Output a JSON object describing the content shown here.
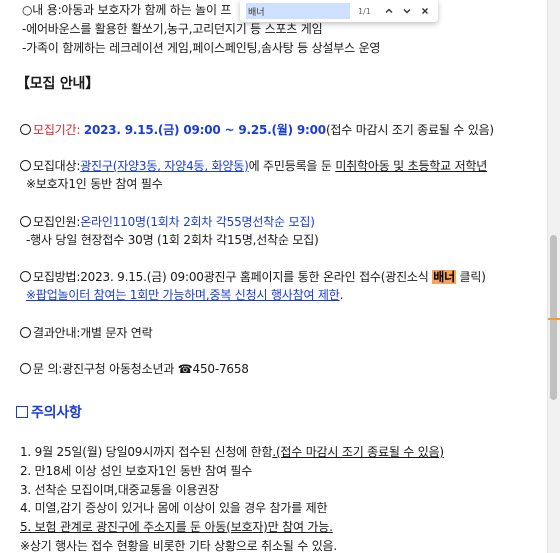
{
  "find_bar": {
    "query": "배너",
    "count": "1/1",
    "prev_icon": "chevron-up-icon",
    "next_icon": "chevron-down-icon",
    "close_icon": "close-icon"
  },
  "intro": {
    "content_label": "○내 용:아동과 보호자가 함께 하는 놀이 프",
    "content_line2": "-에어바운스를 활용한 활쏘기,농구,고리던지기 등 스포츠 게임",
    "content_line3": "-가족이 함께하는 레크레이션 게임,페이스페인팅,솜사탕 등 상설부스 운영"
  },
  "recruit": {
    "heading": "【모집 안내】",
    "period_label": "모집기간: ",
    "period_value": "2023. 9.15.(금) 09:00 ~ 9.25.(월) 9:00",
    "period_note": "(접수 마감시 조기 종료될 수 있음)",
    "target_label": "모집대상:",
    "target_value": "광진구(자양3동, 자양4동, 화양동)",
    "target_rest": "에 주민등록을 둔 ",
    "target_underline": "미취학아동 및 초등학교 저학년",
    "target_note": "※보호자1인 동반 참여 필수",
    "people_label": "모집인원:",
    "people_value": "온라인110명(1회차 2회차 각55명선착순 모집)",
    "people_note": "-행사 당일 현장접수 30명 (1회 2회차 각15명,선착순 모집)",
    "method_prefix": "모집방법:2023. 9.15.(금) 09:00광진구 홈페이지를 통한 온라인 접수(광진소식 ",
    "method_highlight": "배너",
    "method_suffix": " 클릭)",
    "method_note": "※팝업놀이터 참여는 1회만 가능하며,중복 신청시 행사참여 제한",
    "method_note_end": ".",
    "result_text": "결과안내:개별 문자 연락",
    "contact_text": "문 의:광진구청 아동청소년과 ☎450-7658"
  },
  "notice": {
    "heading": "주의사항",
    "item1_prefix": "1. 9월 25일(월) 당일09시까지 접수된 신청에 한함",
    "item1_suffix": ".(접수 마감시 조기 종료될 수 있음)",
    "item2": "2. 만18세 이상 성인 보호자1인 동반 참여 필수",
    "item3": "3. 선착순 모집이며,대중교통을 이용권장",
    "item4": "4. 미열,감기 증상이 있거나 몸에 이상이 있을 경우 참가를 제한",
    "item5": "5. 보험 관계로 광진구에 주소지를 둔 아동(보호자)만 참여 가능.",
    "item6": "※상기 행사는 접수 현황을 비롯한 기타 상황으로 취소될 수 있음."
  }
}
